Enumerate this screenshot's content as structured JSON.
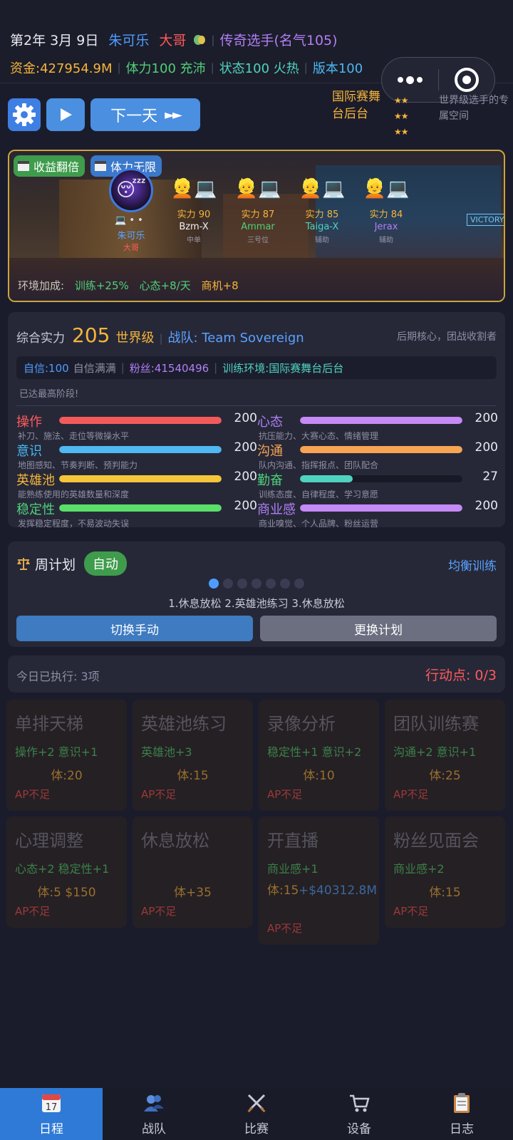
{
  "header": {
    "date": "第2年 3月 9日",
    "player_name": "朱可乐",
    "player_role": "大哥",
    "title": "传奇选手(名气105)",
    "money": "资金:427954.9M",
    "stamina": "体力100 充沛",
    "state": "状态100 火热",
    "version": "版本100"
  },
  "toolbar": {
    "next_day_label": "下一天",
    "next_day_arrows": "►►"
  },
  "venue": {
    "name": "国际赛舞台后台",
    "stars": [
      "★★",
      "★★",
      "★★"
    ],
    "description": "世界级选手的专属空间"
  },
  "scene": {
    "tags": [
      "收益翻倍",
      "体力无限"
    ],
    "self": {
      "name": "朱可乐",
      "role": "大哥"
    },
    "teammates": [
      {
        "power": "实力 90",
        "name": "Bzm-X",
        "role": "中单",
        "name_color": "#f0f0f0"
      },
      {
        "power": "实力 87",
        "name": "Ammar",
        "role": "三号位",
        "name_color": "#50d07a"
      },
      {
        "power": "实力 85",
        "name": "Taiga-X",
        "role": "辅助",
        "name_color": "#4fd3c0"
      },
      {
        "power": "实力 84",
        "name": "Jerax",
        "role": "辅助",
        "name_color": "#b07ff5"
      }
    ],
    "env_label": "环境加成:",
    "env_bonuses": [
      "训练+25%",
      "心态+8/天",
      "商机+8"
    ]
  },
  "stats_panel": {
    "power_label": "综合实力",
    "power_value": "205",
    "grade": "世界级",
    "team": "战队: Team Sovereign",
    "role_desc": "后期核心，团战收割者",
    "confidence": "自信:100",
    "confidence_desc": "自信满满",
    "fans": "粉丝:41540496",
    "environment": "训练环境:国际赛舞台后台",
    "max_stage": "已达最高阶段!",
    "stats": [
      {
        "name": "操作",
        "value": 200,
        "max": 200,
        "desc": "补刀、施法、走位等微操水平",
        "color": "#f25a5a"
      },
      {
        "name": "心态",
        "value": 200,
        "max": 200,
        "desc": "抗压能力、大赛心态、情绪管理",
        "color": "#c58af5"
      },
      {
        "name": "意识",
        "value": 200,
        "max": 200,
        "desc": "地图感知、节奏判断、预判能力",
        "color": "#4fb8f2"
      },
      {
        "name": "沟通",
        "value": 200,
        "max": 200,
        "desc": "队内沟通、指挥报点、团队配合",
        "color": "#f7a552"
      },
      {
        "name": "英雄池",
        "value": 200,
        "max": 200,
        "desc": "能熟练使用的英雄数量和深度",
        "color": "#f5c53a"
      },
      {
        "name": "勤奋",
        "value": 27,
        "max": 83,
        "desc": "训练态度、自律程度、学习意愿",
        "color": "#4fd3c0"
      },
      {
        "name": "稳定性",
        "value": 200,
        "max": 200,
        "desc": "发挥稳定程度，不易波动失误",
        "color": "#5adf6a"
      },
      {
        "name": "商业感",
        "value": 200,
        "max": 200,
        "desc": "商业嗅觉、个人品牌、粉丝运营",
        "color": "#c58af5"
      }
    ],
    "stat_name_colors": [
      "#ff5a5a",
      "#b07ff5",
      "#49b8f2",
      "#f5a552",
      "#f5b53a",
      "#50d07a",
      "#50d07a",
      "#b07ff5"
    ]
  },
  "plan": {
    "title": "周计划",
    "mode_badge": "自动",
    "strategy": "均衡训练",
    "sequence": "1.休息放松  2.英雄池练习  3.休息放松",
    "switch_manual": "切换手动",
    "change_plan": "更换计划"
  },
  "today": {
    "executed": "今日已执行: 3项",
    "action_points": "行动点: 0/3"
  },
  "actions": [
    {
      "title": "单排天梯",
      "effect": "操作+2 意识+1",
      "cost": "体:20",
      "status": "AP不足"
    },
    {
      "title": "英雄池练习",
      "effect": "英雄池+3",
      "cost": "体:15",
      "status": "AP不足"
    },
    {
      "title": "录像分析",
      "effect": "稳定性+1 意识+2",
      "cost": "体:10",
      "status": "AP不足"
    },
    {
      "title": "团队训练赛",
      "effect": "沟通+2 意识+1",
      "cost": "体:25",
      "status": "AP不足"
    },
    {
      "title": "心理调整",
      "effect": "心态+2 稳定性+1",
      "cost": "体:5 $150",
      "status": "AP不足"
    },
    {
      "title": "休息放松",
      "effect": "",
      "cost": "体+35",
      "status": "AP不足"
    },
    {
      "title": "开直播",
      "effect": "商业感+1",
      "cost_left": "体:15",
      "cost_right": "+$40312.8M",
      "status": "AP不足"
    },
    {
      "title": "粉丝见面会",
      "effect": "商业感+2",
      "cost": "体:15",
      "status": "AP不足"
    }
  ],
  "nav": [
    {
      "label": "日程",
      "icon": "calendar-icon",
      "active": true
    },
    {
      "label": "战队",
      "icon": "team-icon",
      "active": false
    },
    {
      "label": "比赛",
      "icon": "crossed-swords-icon",
      "active": false
    },
    {
      "label": "设备",
      "icon": "cart-icon",
      "active": false
    },
    {
      "label": "日志",
      "icon": "clipboard-icon",
      "active": false
    }
  ]
}
